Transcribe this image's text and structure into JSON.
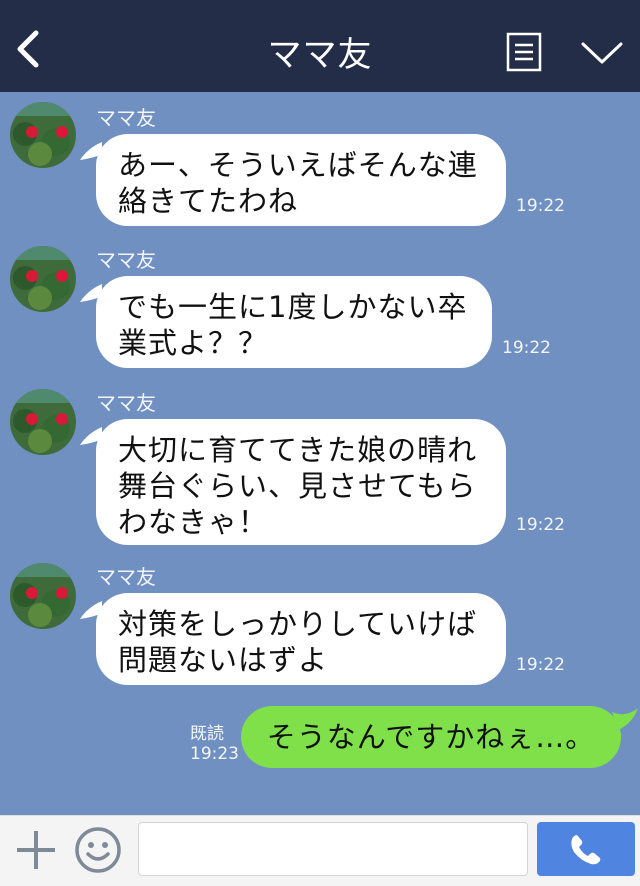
{
  "header": {
    "title": "ママ友",
    "back_icon": "chevron-left-icon",
    "notes_icon": "notes-icon",
    "menu_icon": "chevron-down-icon",
    "background": "#242d48"
  },
  "chat": {
    "background": "#7090c1",
    "messages": [
      {
        "sender": "ママ友",
        "line1": "あー、そういえばそんな連",
        "line2": "絡きてたわね",
        "time": "19:22"
      },
      {
        "sender": "ママ友",
        "line1": "でも一生に1度しかない卒",
        "line2": "業式よ？？",
        "time": "19:22"
      },
      {
        "sender": "ママ友",
        "line1": "大切に育ててきた娘の晴れ",
        "line2": "舞台ぐらい、見させてもら",
        "line3": "わなきゃ！",
        "time": "19:22"
      },
      {
        "sender": "ママ友",
        "line1": "対策をしっかりしていけば",
        "line2": "問題ないはずよ",
        "time": "19:22"
      }
    ],
    "sent": {
      "text": "そうなんですかねぇ…。",
      "read_label": "既読",
      "time": "19:23",
      "color": "#7fe04a"
    }
  },
  "composer": {
    "plus_icon": "plus-icon",
    "emoji_icon": "smiley-icon",
    "input_value": "",
    "call_icon": "phone-icon",
    "call_color": "#4f84e0"
  }
}
